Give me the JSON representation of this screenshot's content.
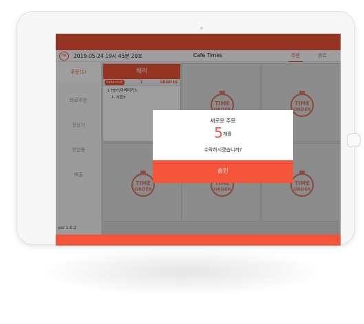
{
  "header": {
    "logo_text": "TO",
    "datetime": "2019-05-24 19시 45분 20초",
    "title": "Cafe Times",
    "tabs": [
      {
        "label": "주문",
        "active": true
      },
      {
        "label": "완료",
        "active": false
      }
    ]
  },
  "sidebar": {
    "items": [
      {
        "label": "주문(1)",
        "active": true
      },
      {
        "label": "바로주문",
        "active": false
      },
      {
        "label": "정상가",
        "active": false
      },
      {
        "label": "영업중",
        "active": false
      },
      {
        "label": "매출",
        "active": false
      }
    ],
    "version": "ver 1.0.2"
  },
  "order_card": {
    "name": "해리",
    "type": "take-out",
    "count": "1",
    "price": "4848:19",
    "items": [
      "1  HOT/아메리카노",
      "ㄴ 시럽X"
    ]
  },
  "empty_slot_logo": [
    "TIME",
    "ORDER"
  ],
  "modal": {
    "title": "새로운 주문",
    "count": "5",
    "count_suffix": "개를",
    "question": "수락하시겠습니까?",
    "approve_label": "승인"
  },
  "colors": {
    "accent": "#f2553a",
    "overlay": "rgba(0,0,0,0.38)"
  }
}
